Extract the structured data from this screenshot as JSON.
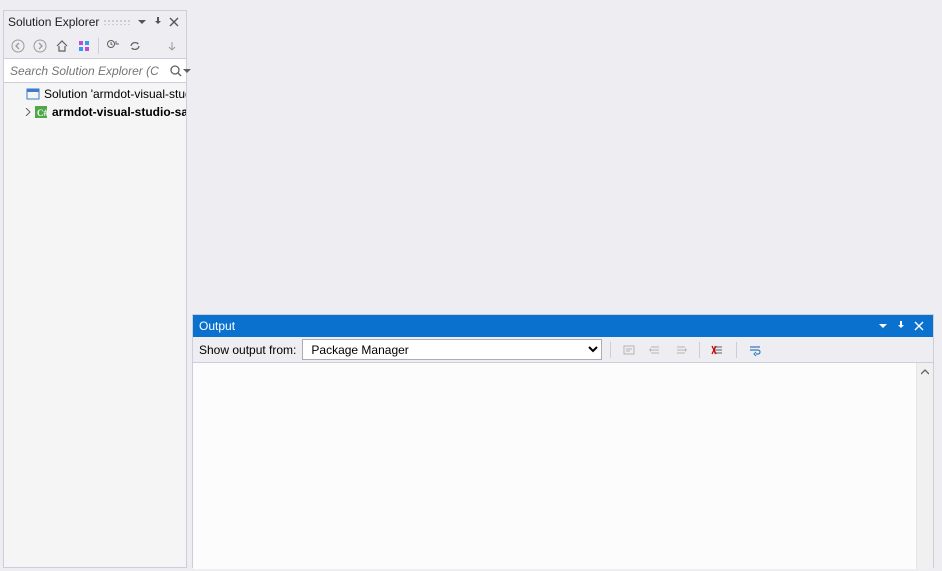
{
  "solution_explorer": {
    "title": "Solution Explorer",
    "search_placeholder": "Search Solution Explorer (C",
    "tree": {
      "solution_label": "Solution 'armdot-visual-stud",
      "project_label": "armdot-visual-studio-sa"
    }
  },
  "output_panel": {
    "title": "Output",
    "show_from_label": "Show output from:",
    "selected_source": "Package Manager"
  }
}
